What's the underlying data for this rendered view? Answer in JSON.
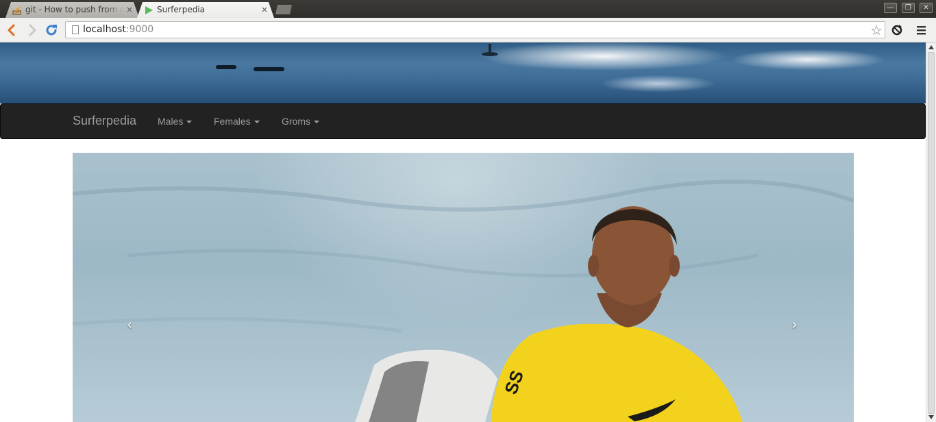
{
  "browser": {
    "tabs": [
      {
        "title": "git - How to push from my",
        "active": false,
        "icon": "stackoverflow-icon"
      },
      {
        "title": "Surferpedia",
        "active": true,
        "icon": "play-icon"
      }
    ],
    "tab_close": "×",
    "url_host": "localhost",
    "url_port": ":9000",
    "window_controls": {
      "minimize": "—",
      "restore": "❐",
      "close": "✕"
    }
  },
  "site": {
    "brand": "Surferpedia",
    "nav": [
      {
        "label": "Males"
      },
      {
        "label": "Females"
      },
      {
        "label": "Groms"
      }
    ]
  },
  "carousel": {
    "prev": "‹",
    "next": "›"
  },
  "colors": {
    "navbar_bg": "#222222",
    "navbar_text": "#9d9d9d",
    "jersey_yellow": "#f2d21c"
  }
}
